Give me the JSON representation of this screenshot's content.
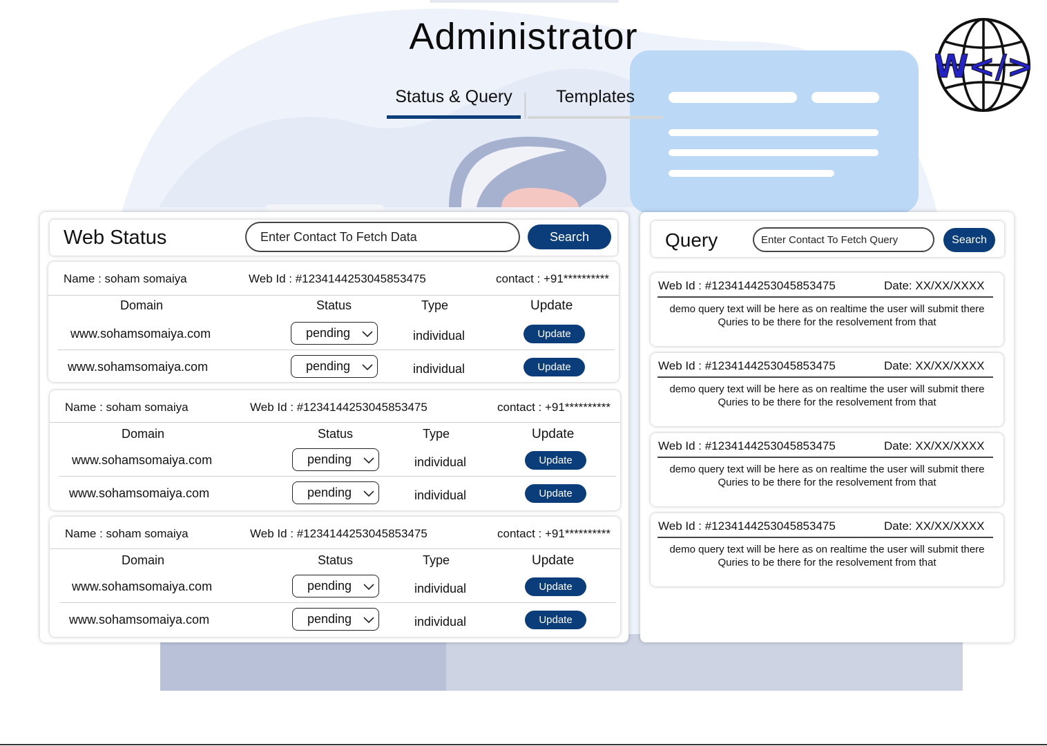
{
  "app": {
    "title": "Administrator",
    "logo_label": "W</>",
    "logo_icon": "globe-code-logo-icon"
  },
  "colors": {
    "primary": "#0b3d7a",
    "tab_inactive_underline": "#d6d6d6",
    "illustration_blue": "#bcd8f7",
    "illustration_lavender": "#e8edf8"
  },
  "tabs": [
    {
      "label": "Status & Query",
      "active": true
    },
    {
      "label": "Templates",
      "active": false
    }
  ],
  "web_status": {
    "title": "Web Status",
    "search": {
      "placeholder": "Enter Contact To Fetch Data",
      "value": ""
    },
    "search_button": "Search",
    "columns": {
      "domain": "Domain",
      "status": "Status",
      "type": "Type",
      "update": "Update"
    },
    "records": [
      {
        "name": "Name : soham somaiya",
        "web_id": "Web Id : #1234144253045853475",
        "contact": "contact : +91**********",
        "rows": [
          {
            "domain": "www.sohamsomaiya.com",
            "status": "pending",
            "type": "individual",
            "action": "Update"
          },
          {
            "domain": "www.sohamsomaiya.com",
            "status": "pending",
            "type": "individual",
            "action": "Update"
          }
        ]
      },
      {
        "name": "Name : soham somaiya",
        "web_id": "Web Id : #1234144253045853475",
        "contact": "contact : +91**********",
        "rows": [
          {
            "domain": "www.sohamsomaiya.com",
            "status": "pending",
            "type": "individual",
            "action": "Update"
          },
          {
            "domain": "www.sohamsomaiya.com",
            "status": "pending",
            "type": "individual",
            "action": "Update"
          }
        ]
      },
      {
        "name": "Name : soham somaiya",
        "web_id": "Web Id : #1234144253045853475",
        "contact": "contact : +91**********",
        "rows": [
          {
            "domain": "www.sohamsomaiya.com",
            "status": "pending",
            "type": "individual",
            "action": "Update"
          },
          {
            "domain": "www.sohamsomaiya.com",
            "status": "pending",
            "type": "individual",
            "action": "Update"
          }
        ]
      }
    ]
  },
  "query": {
    "title": "Query",
    "search": {
      "placeholder": "Enter Contact To Fetch Query",
      "value": ""
    },
    "search_button": "Search",
    "items": [
      {
        "web_id": "Web Id : #1234144253045853475",
        "date": "Date: XX/XX/XXXX",
        "text": "demo query text will be here as on realtime the user will submit there Quries to be there for the resolvement from that"
      },
      {
        "web_id": "Web Id : #1234144253045853475",
        "date": "Date: XX/XX/XXXX",
        "text": "demo query text will be here as on realtime the user will submit there Quries to be there for the resolvement from that"
      },
      {
        "web_id": "Web Id : #1234144253045853475",
        "date": "Date: XX/XX/XXXX",
        "text": "demo query text will be here as on realtime the user will submit there Quries to be there for the resolvement from that"
      },
      {
        "web_id": "Web Id : #1234144253045853475",
        "date": "Date: XX/XX/XXXX",
        "text": "demo query text will be here as on realtime the user will submit there Quries to be there for the resolvement from that"
      }
    ]
  }
}
